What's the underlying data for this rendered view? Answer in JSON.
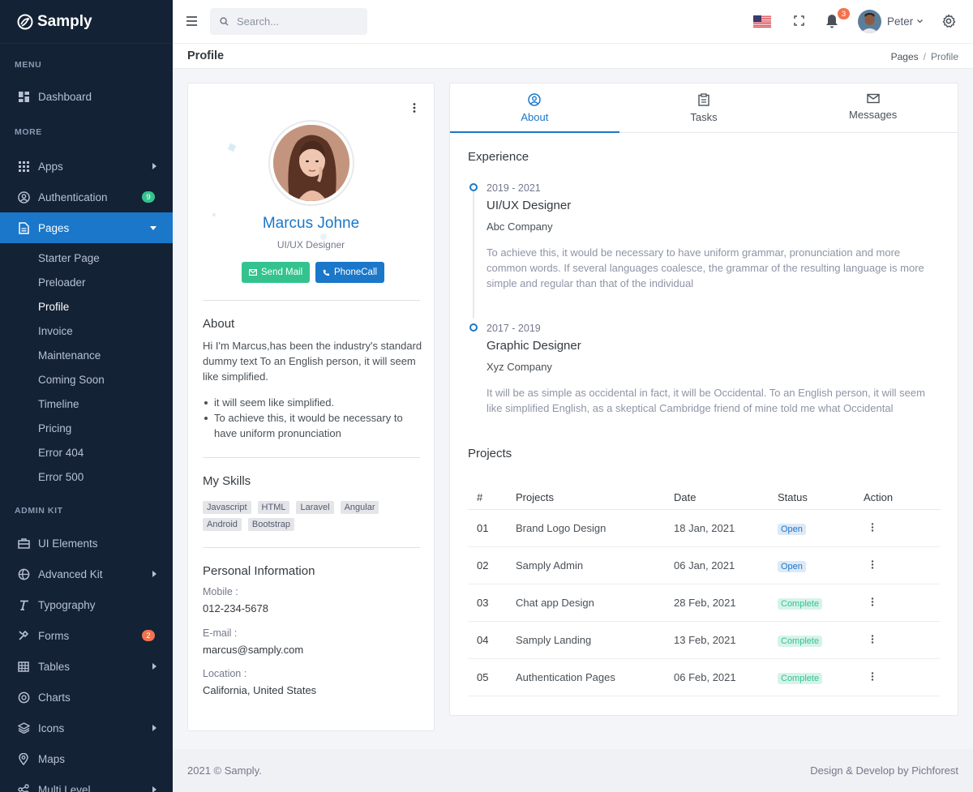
{
  "app": {
    "brand": "Samply"
  },
  "sidebar": {
    "menu_title": "MENU",
    "more_title": "MORE",
    "adminkit_title": "ADMIN KIT",
    "dashboard": "Dashboard",
    "apps": "Apps",
    "authentication": "Authentication",
    "authentication_badge": "9",
    "pages": "Pages",
    "pages_sub": [
      "Starter Page",
      "Preloader",
      "Profile",
      "Invoice",
      "Maintenance",
      "Coming Soon",
      "Timeline",
      "Pricing",
      "Error 404",
      "Error 500"
    ],
    "ui_elements": "UI Elements",
    "advanced_kit": "Advanced Kit",
    "typography": "Typography",
    "forms": "Forms",
    "forms_badge": "2",
    "tables": "Tables",
    "charts": "Charts",
    "icons": "Icons",
    "maps": "Maps",
    "multi_level": "Multi Level",
    "colors": {
      "badge_green": "#34c38f",
      "badge_orange": "#f1734f",
      "active": "#1a77c9"
    }
  },
  "topbar": {
    "search_placeholder": "Search...",
    "notification_count": "3",
    "user_name": "Peter"
  },
  "titlebar": {
    "title": "Profile",
    "breadcrumb": [
      "Pages",
      "Profile"
    ]
  },
  "profile": {
    "name": "Marcus Johne",
    "role": "UI/UX Designer",
    "send_mail": "Send Mail",
    "phone_call": "PhoneCall",
    "about_title": "About",
    "about_text": "Hi I'm Marcus,has been the industry's standard dummy text To an English person, it will seem like simplified.",
    "about_points": [
      "it will seem like simplified.",
      "To achieve this, it would be necessary to have uniform pronunciation"
    ],
    "skills_title": "My Skills",
    "skills": [
      "Javascript",
      "HTML",
      "Laravel",
      "Angular",
      "Android",
      "Bootstrap"
    ],
    "personal_title": "Personal Information",
    "mobile_label": "Mobile :",
    "mobile": "012-234-5678",
    "email_label": "E-mail :",
    "email": "marcus@samply.com",
    "location_label": "Location :",
    "location": "California, United States"
  },
  "tabs": [
    "About",
    "Tasks",
    "Messages"
  ],
  "experience": {
    "title": "Experience",
    "items": [
      {
        "years": "2019 - 2021",
        "role": "UI/UX Designer",
        "company": "Abc Company",
        "desc": "To achieve this, it would be necessary to have uniform grammar, pronunciation and more common words. If several languages coalesce, the grammar of the resulting language is more simple and regular than that of the individual"
      },
      {
        "years": "2017 - 2019",
        "role": "Graphic Designer",
        "company": "Xyz Company",
        "desc": "It will be as simple as occidental in fact, it will be Occidental. To an English person, it will seem like simplified English, as a skeptical Cambridge friend of mine told me what Occidental"
      }
    ]
  },
  "projects": {
    "title": "Projects",
    "columns": [
      "#",
      "Projects",
      "Date",
      "Status",
      "Action"
    ],
    "rows": [
      {
        "num": "01",
        "name": "Brand Logo Design",
        "date": "18 Jan, 2021",
        "status": "Open"
      },
      {
        "num": "02",
        "name": "Samply Admin",
        "date": "06 Jan, 2021",
        "status": "Open"
      },
      {
        "num": "03",
        "name": "Chat app Design",
        "date": "28 Feb, 2021",
        "status": "Complete"
      },
      {
        "num": "04",
        "name": "Samply Landing",
        "date": "13 Feb, 2021",
        "status": "Complete"
      },
      {
        "num": "05",
        "name": "Authentication Pages",
        "date": "06 Feb, 2021",
        "status": "Complete"
      }
    ]
  },
  "footer": {
    "left": "2021 © Samply.",
    "right": "Design & Develop by Pichforest"
  }
}
